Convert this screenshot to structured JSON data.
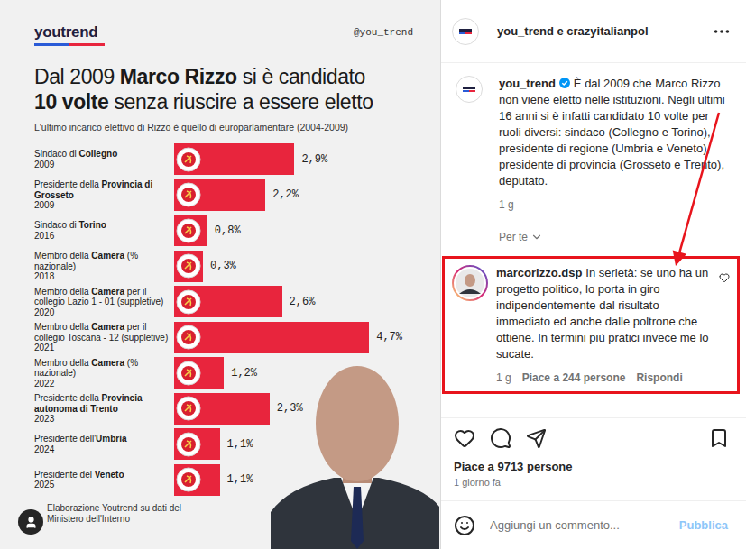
{
  "image": {
    "logo": "youtrend",
    "handle": "@you_trend",
    "title_lines": [
      [
        {
          "text": "Dal 2009 ",
          "bold": false
        },
        {
          "text": "Marco Rizzo",
          "bold": true
        },
        {
          "text": " si è candidato",
          "bold": false
        }
      ],
      [
        {
          "text": "10 volte",
          "bold": true
        },
        {
          "text": " senza riuscire a essere eletto",
          "bold": false
        }
      ]
    ],
    "subtitle": "L'ultimo incarico elettivo di Rizzo è quello di europarlamentare (2004-2009)",
    "chart": {
      "rows": [
        {
          "label": [
            {
              "text": "Sindaco di ",
              "bold": false
            },
            {
              "text": "Collegno",
              "bold": true
            }
          ],
          "year": "2009",
          "value": 2.9,
          "reading": "2,9%"
        },
        {
          "label": [
            {
              "text": "Presidente della ",
              "bold": false
            },
            {
              "text": "Provincia di Grosseto",
              "bold": true
            }
          ],
          "year": "2009",
          "value": 2.2,
          "reading": "2,2%"
        },
        {
          "label": [
            {
              "text": "Sindaco di ",
              "bold": false
            },
            {
              "text": "Torino",
              "bold": true
            }
          ],
          "year": "2016",
          "value": 0.8,
          "reading": "0,8%"
        },
        {
          "label": [
            {
              "text": "Membro della ",
              "bold": false
            },
            {
              "text": "Camera",
              "bold": true
            },
            {
              "text": " (% nazionale)",
              "bold": false
            }
          ],
          "year": "2018",
          "value": 0.3,
          "reading": "0,3%"
        },
        {
          "label": [
            {
              "text": "Membro della ",
              "bold": false
            },
            {
              "text": "Camera",
              "bold": true
            },
            {
              "text": " per il collegio Lazio 1 - 01 (suppletive)",
              "bold": false
            }
          ],
          "year": "2020",
          "value": 2.6,
          "reading": "2,6%"
        },
        {
          "label": [
            {
              "text": "Membro della ",
              "bold": false
            },
            {
              "text": "Camera",
              "bold": true
            },
            {
              "text": " per il collegio Toscana - 12 (suppletive)",
              "bold": false
            }
          ],
          "year": "2021",
          "value": 4.7,
          "reading": "4,7%"
        },
        {
          "label": [
            {
              "text": "Membro della ",
              "bold": false
            },
            {
              "text": "Camera",
              "bold": true
            },
            {
              "text": " (% nazionale)",
              "bold": false
            }
          ],
          "year": "2022",
          "value": 1.2,
          "reading": "1,2%"
        },
        {
          "label": [
            {
              "text": "Presidente della ",
              "bold": false
            },
            {
              "text": "Provincia autonoma di Trento",
              "bold": true
            }
          ],
          "year": "2023",
          "value": 2.3,
          "reading": "2,3%"
        },
        {
          "label": [
            {
              "text": "Presidente dell'",
              "bold": false
            },
            {
              "text": "Umbria",
              "bold": true
            }
          ],
          "year": "2024",
          "value": 1.1,
          "reading": "1,1%"
        },
        {
          "label": [
            {
              "text": "Presidente del ",
              "bold": false
            },
            {
              "text": "Veneto",
              "bold": true
            }
          ],
          "year": "2025",
          "value": 1.1,
          "reading": "1,1%"
        }
      ]
    },
    "source": "Elaborazione Youtrend su dati del Ministero dell'Interno"
  },
  "header": {
    "accounts": "you_trend e crazyitalianpol"
  },
  "caption": {
    "username": "you_trend",
    "verified": true,
    "text": "È dal 2009 che Marco Rizzo non viene eletto nelle istituzioni. Negli ultimi 16 anni si è infatti candidato 10 volte per ruoli diversi: sindaco (Collegno e Torino), presidente di regione (Umbria e Veneto), presidente di provincia (Grosseto e Trento), deputato.",
    "time": "1 g"
  },
  "translation": {
    "label": "Per te"
  },
  "comments": [
    {
      "username": "marcorizzo.dsp",
      "text": "In serietà: se uno ha un progetto politico, lo porta in giro indipendentemente dal risultato immediato ed anche dalle poltrone che ottiene. In termini più pratici invece me lo sucate.",
      "time": "1 g",
      "likes": "Piace a 244 persone",
      "reply": "Rispondi",
      "liked": false,
      "highlighted": true
    }
  ],
  "post": {
    "liked": false,
    "saved": false,
    "likes": "Piace a 9713 persone",
    "date": "1 giorno fa"
  },
  "composer": {
    "placeholder": "Aggiungi un commento...",
    "submit": "Pubblica"
  },
  "annotation": {
    "arrow": true
  }
}
